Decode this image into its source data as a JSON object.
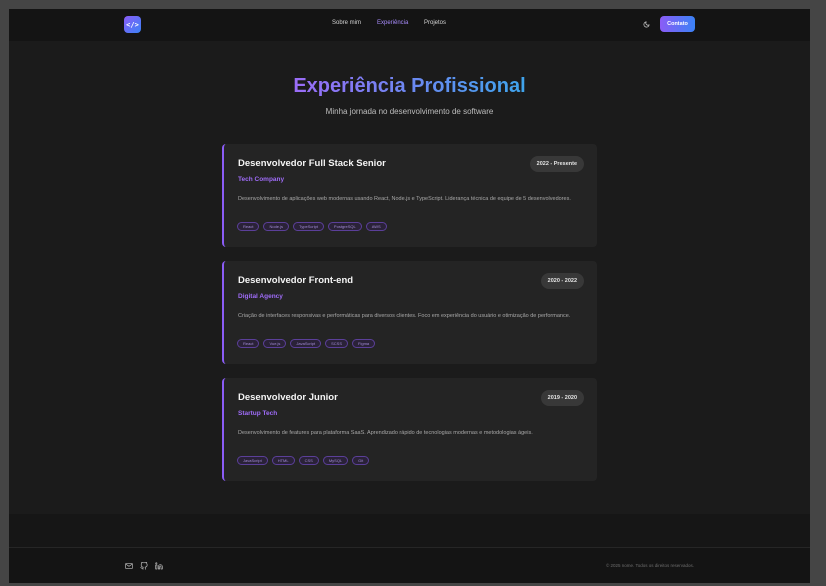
{
  "nav": {
    "logo_text": "</>",
    "links": [
      {
        "label": "Sobre mim"
      },
      {
        "label": "Experiência"
      },
      {
        "label": "Projetos"
      }
    ],
    "contact_label": "Contato"
  },
  "section": {
    "title": "Experiência Profissional",
    "subtitle": "Minha jornada no desenvolvimento de software"
  },
  "experiences": [
    {
      "title": "Desenvolvedor Full Stack Senior",
      "period": "2022 - Presente",
      "company": "Tech Company",
      "description": "Desenvolvimento de aplicações web modernas usando React, Node.js e TypeScript. Liderança técnica de equipe de 5 desenvolvedores.",
      "tags": [
        "React",
        "Node.js",
        "TypeScript",
        "PostgreSQL",
        "AWS"
      ]
    },
    {
      "title": "Desenvolvedor Front-end",
      "period": "2020 - 2022",
      "company": "Digital Agency",
      "description": "Criação de interfaces responsivas e performáticas para diversos clientes. Foco em experiência do usuário e otimização de performance.",
      "tags": [
        "React",
        "Vue.js",
        "JavaScript",
        "SCSS",
        "Figma"
      ]
    },
    {
      "title": "Desenvolvedor Junior",
      "period": "2019 - 2020",
      "company": "Startup Tech",
      "description": "Desenvolvimento de features para plataforma SaaS. Aprendizado rápido de tecnologias modernas e metodologias ágeis.",
      "tags": [
        "JavaScript",
        "HTML",
        "CSS",
        "MySQL",
        "Git"
      ]
    }
  ],
  "footer": {
    "icons": [
      "mail-icon",
      "github-icon",
      "linkedin-icon"
    ],
    "copyright": "© 2025 nome. Todos os direitos reservados."
  },
  "colors": {
    "accent": "#8b5cf6",
    "accent_blue": "#3b82f6",
    "background": "#1b1b1b",
    "card": "#242424"
  }
}
